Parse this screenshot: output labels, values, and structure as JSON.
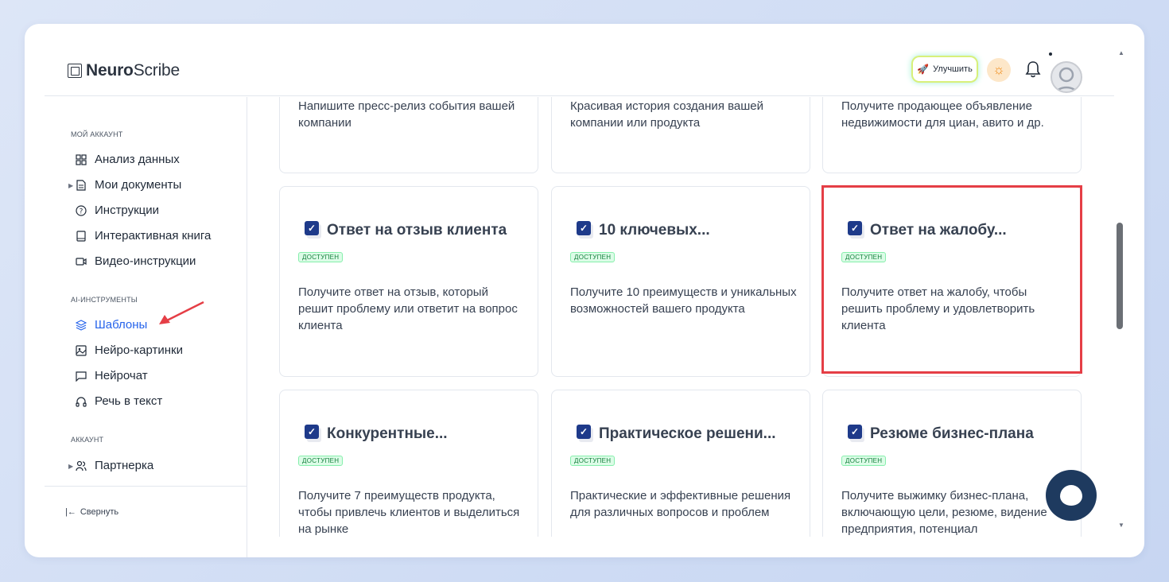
{
  "app": {
    "logo_bold": "Neuro",
    "logo_regular": "Scribe"
  },
  "header": {
    "upgrade_label": "Улучшить"
  },
  "sidebar": {
    "section_account": "МОЙ АККАУНТ",
    "items_account": [
      {
        "label": "Анализ данных",
        "icon": "grid-icon"
      },
      {
        "label": "Мои документы",
        "icon": "file-icon"
      },
      {
        "label": "Инструкции",
        "icon": "help-circle-icon"
      },
      {
        "label": "Интерактивная книга",
        "icon": "book-icon"
      },
      {
        "label": "Видео-инструкции",
        "icon": "video-icon"
      }
    ],
    "section_ai": "AI-ИНСТРУМЕНТЫ",
    "items_ai": [
      {
        "label": "Шаблоны",
        "icon": "layers-icon"
      },
      {
        "label": "Нейро-картинки",
        "icon": "image-icon"
      },
      {
        "label": "Нейрочат",
        "icon": "chat-icon"
      },
      {
        "label": "Речь в текст",
        "icon": "headphones-icon"
      }
    ],
    "section_acc2": "АККАУНТ",
    "items_acc2": [
      {
        "label": "Партнерка",
        "icon": "users-icon"
      }
    ],
    "collapse_label": "Свернуть"
  },
  "cards_top": [
    {
      "desc": "Напишите пресс-релиз события вашей компании"
    },
    {
      "desc": "Красивая история создания вашей компании или продукта"
    },
    {
      "desc": "Получите продающее объявление недвижимости для циан, авито и др."
    }
  ],
  "cards": [
    {
      "title": "Ответ на отзыв клиента",
      "badge": "доступен",
      "desc": "Получите ответ на отзыв, который решит проблему или ответит на вопрос клиента"
    },
    {
      "title": "10 ключевых...",
      "badge": "доступен",
      "desc": "Получите 10 преимуществ и уникальных возможностей вашего продукта"
    },
    {
      "title": "Ответ на жалобу...",
      "badge": "доступен",
      "desc": "Получите ответ на жалобу, чтобы решить проблему и удовлетворить клиента"
    },
    {
      "title": "Конкурентные...",
      "badge": "доступен",
      "desc": "Получите 7 преимуществ продукта, чтобы привлечь клиентов и выделиться на рынке"
    },
    {
      "title": "Практическое решени...",
      "badge": "доступен",
      "desc": "Практические и эффективные решения для различных вопросов и проблем"
    },
    {
      "title": "Резюме бизнес-плана",
      "badge": "доступен",
      "desc": "Получите выжимку бизнес-плана, включающую цели, резюме, видение предприятия, потенциал"
    }
  ],
  "colors": {
    "accent": "#2563eb",
    "highlight": "#e53e46",
    "badge_green": "#15803d",
    "chat_button": "#1e3a5f"
  }
}
